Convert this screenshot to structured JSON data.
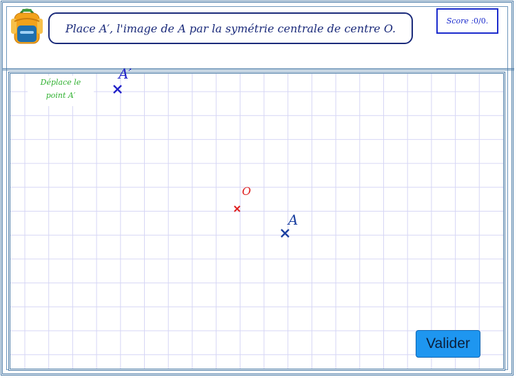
{
  "header": {
    "instruction_text": "Place A′, l'image de A par la symétrie centrale de centre O.",
    "score_label": "Score : ",
    "score_value": "0/0."
  },
  "board": {
    "hint_text": "Déplace le\npoint A′",
    "points": {
      "a_prime_label": "A′",
      "o_label": "O",
      "a_label": "A"
    }
  },
  "actions": {
    "validate_label": "Valider"
  },
  "colors": {
    "frame": "#4a7aa6",
    "grid": "#d6d6f5",
    "instruction": "#1a2a7a",
    "score": "#1a2acc",
    "hint": "#2fb12f",
    "point_a_prime": "#2020c8",
    "point_o": "#e02020",
    "point_a": "#1a3fa0",
    "button": "#1e96f0"
  },
  "icons": {
    "logo": "backpack-icon"
  }
}
